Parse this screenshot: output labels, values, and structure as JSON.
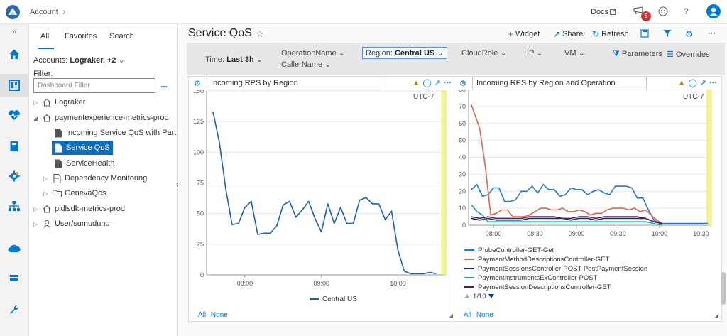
{
  "topbar": {
    "account_label": "Account",
    "docs_label": "Docs",
    "notification_count": "5",
    "help_label": "?"
  },
  "sidebar_tabs": [
    "All",
    "Favorites",
    "Search"
  ],
  "accounts": {
    "label": "Accounts:",
    "value": "Lograker, +2"
  },
  "filter": {
    "label": "Filter:",
    "placeholder": "Dashboard Filter",
    "more": "..."
  },
  "tree": [
    {
      "label": "Lograker",
      "icon": "home-icon",
      "caret": "right"
    },
    {
      "label": "paymentexperience-metrics-prod",
      "icon": "home-icon",
      "caret": "down"
    },
    {
      "label": "Incoming Service QoS with Partn",
      "icon": "document-icon",
      "caret": "none"
    },
    {
      "label": "Service QoS",
      "icon": "document-icon",
      "caret": "none",
      "selected": true
    },
    {
      "label": "ServiceHealth",
      "icon": "document-icon",
      "caret": "none"
    },
    {
      "label": "Dependency Monitoring",
      "icon": "document-list-icon",
      "caret": "right"
    },
    {
      "label": "GenevaQos",
      "icon": "folder-icon",
      "caret": "right"
    },
    {
      "label": "pidlsdk-metrics-prod",
      "icon": "home-icon",
      "caret": "right"
    },
    {
      "label": "User/sumudunu",
      "icon": "person-icon",
      "caret": "right"
    }
  ],
  "page": {
    "title": "Service QoS",
    "commands": {
      "widget": "Widget",
      "share": "Share",
      "refresh": "Refresh"
    }
  },
  "filters": {
    "time_label": "Time:",
    "time_value": "Last 3h",
    "operation_name": "OperationName",
    "caller_name": "CallerName",
    "region_label": "Region:",
    "region_value": "Central US",
    "cloud_role": "CloudRole",
    "ip": "IP",
    "vm": "VM",
    "parameters": "Parameters",
    "overrides": "Overrides"
  },
  "colors": {
    "accent": "#0078d4",
    "selected_bg": "#0f6cbd",
    "badge": "#d13438",
    "marker": "#f6f58e"
  },
  "chart_data": [
    {
      "type": "line",
      "title": "Incoming RPS by Region",
      "timezone_label": "UTC-7",
      "x_ticks": [
        "08:00",
        "09:00",
        "10:00"
      ],
      "x_tick_minutes": [
        480,
        540,
        600
      ],
      "y_ticks": [
        0,
        25,
        50,
        75,
        100,
        125,
        150
      ],
      "ylim": [
        0,
        150
      ],
      "xlim_minutes": [
        450,
        637
      ],
      "legend_position": "bottom",
      "footer_links": [
        "All",
        "None"
      ],
      "series": [
        {
          "name": "Central US",
          "color": "#1f5fad",
          "x_minutes": [
            455,
            460,
            465,
            470,
            475,
            480,
            485,
            490,
            495,
            500,
            505,
            510,
            515,
            520,
            525,
            530,
            535,
            540,
            545,
            550,
            555,
            560,
            565,
            570,
            575,
            580,
            585,
            590,
            595,
            600,
            605,
            610,
            615,
            620,
            625,
            630
          ],
          "values": [
            133,
            108,
            70,
            41,
            42,
            55,
            60,
            33,
            34,
            34,
            40,
            57,
            60,
            47,
            53,
            60,
            46,
            35,
            58,
            42,
            55,
            42,
            42,
            61,
            63,
            58,
            58,
            45,
            52,
            20,
            3,
            1,
            1,
            1,
            2,
            1
          ]
        }
      ]
    },
    {
      "type": "line",
      "title": "Incoming RPS by Region and Operation",
      "timezone_label": "UTC-7",
      "x_ticks": [
        "08:00",
        "08:30",
        "09:00",
        "09:30",
        "10:00",
        "10:30"
      ],
      "x_tick_minutes": [
        480,
        510,
        540,
        570,
        600,
        630
      ],
      "y_ticks": [
        0,
        10,
        20,
        30,
        40,
        50,
        60,
        70,
        80
      ],
      "ylim": [
        0,
        80
      ],
      "xlim_minutes": [
        462,
        637
      ],
      "legend_position": "bottom",
      "legend_page": "1/10",
      "footer_links": [
        "All",
        "None"
      ],
      "series": [
        {
          "name": "ProbeController-GET-Get",
          "color": "#1f77d4",
          "x_minutes": [
            464,
            468,
            472,
            476,
            480,
            484,
            488,
            492,
            496,
            500,
            504,
            508,
            512,
            516,
            520,
            524,
            528,
            532,
            536,
            540,
            544,
            548,
            552,
            556,
            560,
            564,
            568,
            572,
            576,
            580,
            584,
            588,
            592,
            596,
            600,
            604,
            608,
            612,
            616,
            620,
            625,
            630,
            635
          ],
          "values": [
            21,
            24,
            17,
            18,
            22,
            22,
            14,
            14,
            15,
            20,
            20,
            23,
            19,
            24,
            21,
            21,
            17,
            18,
            22,
            21,
            21,
            18,
            20,
            21,
            19,
            18,
            23,
            23,
            23,
            22,
            16,
            16,
            9,
            3,
            1,
            1,
            1,
            1,
            1,
            1,
            1,
            1,
            1
          ]
        },
        {
          "name": "PaymentMethodDescriptionsController-GET",
          "color": "#e8604a",
          "x_minutes": [
            464,
            470,
            474,
            478,
            482,
            486,
            490,
            494,
            498,
            502,
            506,
            510,
            514,
            518,
            522,
            526,
            530,
            534,
            538,
            542,
            546,
            550,
            554,
            558,
            562,
            566,
            570,
            574,
            578,
            582,
            586,
            590,
            594,
            598,
            602
          ],
          "values": [
            71,
            57,
            35,
            6,
            7,
            9,
            9,
            5,
            5,
            5,
            6,
            8,
            10,
            10,
            9,
            9,
            10,
            8,
            8,
            9,
            8,
            6,
            7,
            7,
            9,
            10,
            10,
            10,
            9,
            10,
            8,
            9,
            6,
            3,
            1
          ]
        },
        {
          "name": "PaymentSessionsController-POST-PostPaymentSession",
          "color": "#102a86",
          "x_minutes": [
            464,
            470,
            476,
            482,
            488,
            494,
            500,
            506,
            512,
            518,
            524,
            530,
            536,
            542,
            548,
            554,
            560,
            566,
            572,
            578,
            584,
            590,
            596,
            602
          ],
          "values": [
            4,
            3,
            4,
            3,
            3,
            3,
            3,
            4,
            4,
            4,
            4,
            4,
            3,
            4,
            4,
            3,
            4,
            4,
            4,
            4,
            4,
            4,
            2,
            1
          ]
        },
        {
          "name": "PaymentInstrumentsExController-POST",
          "color": "#1fa896",
          "x_minutes": [
            464,
            468,
            472,
            476,
            482,
            488,
            494,
            500,
            506,
            512,
            518,
            524,
            530,
            536,
            542,
            548,
            554,
            560,
            566,
            572,
            578,
            584,
            590,
            596,
            602
          ],
          "values": [
            12,
            8,
            6,
            2,
            2,
            2,
            2,
            2,
            2,
            2,
            2,
            2,
            2,
            2,
            2,
            2,
            2,
            2,
            2,
            2,
            2,
            2,
            2,
            1,
            0
          ]
        },
        {
          "name": "PaymentSessionDescriptionsController-GET",
          "color": "#5a1a5e",
          "x_minutes": [
            464,
            470,
            476,
            482,
            488,
            494,
            500,
            506,
            512,
            518,
            524,
            530,
            536,
            542,
            548,
            554,
            560,
            566,
            572,
            578,
            584,
            590,
            596,
            602
          ],
          "values": [
            5,
            4,
            5,
            4,
            4,
            4,
            4,
            5,
            5,
            5,
            5,
            4,
            4,
            5,
            5,
            4,
            5,
            5,
            5,
            5,
            5,
            4,
            2,
            1
          ]
        }
      ]
    }
  ]
}
